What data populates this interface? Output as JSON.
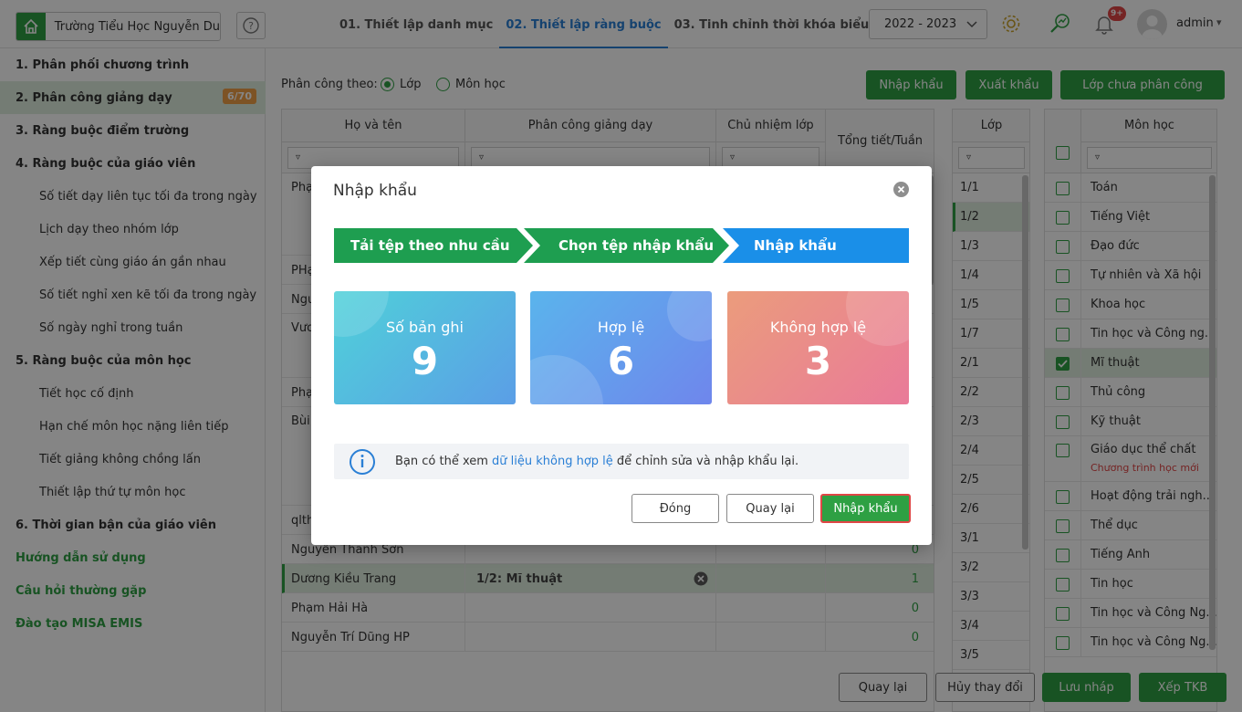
{
  "header": {
    "school_name": "Trường Tiểu Học Nguyễn Du",
    "steps": [
      {
        "label": "01. Thiết lập danh mục"
      },
      {
        "label": "02. Thiết lập ràng buộc"
      },
      {
        "label": "03. Tinh chỉnh thời khóa biểu"
      }
    ],
    "year": "2022 - 2023",
    "notification_badge": "9+",
    "username": "admin"
  },
  "sidebar": {
    "items": [
      {
        "label": "1. Phân phối chương trình"
      },
      {
        "label": "2. Phân công giảng dạy",
        "badge": "6/70"
      },
      {
        "label": "3. Ràng buộc điểm trường"
      },
      {
        "label": "4. Ràng buộc của giáo viên"
      },
      {
        "label": "Số tiết dạy liên tục tối đa trong ngày"
      },
      {
        "label": "Lịch dạy theo nhóm lớp"
      },
      {
        "label": "Xếp tiết cùng giáo án gần nhau"
      },
      {
        "label": "Số tiết nghỉ xen kẽ tối đa trong ngày"
      },
      {
        "label": "Số ngày nghỉ trong tuần"
      },
      {
        "label": "5. Ràng buộc của môn học"
      },
      {
        "label": "Tiết học cố định"
      },
      {
        "label": "Hạn chế môn học nặng liên tiếp"
      },
      {
        "label": "Tiết giảng không chồng lấn"
      },
      {
        "label": "Thiết lập thứ tự môn học"
      },
      {
        "label": "6. Thời gian bận của giáo viên"
      },
      {
        "label": "Hướng dẫn sử dụng"
      },
      {
        "label": "Câu hỏi thường gặp"
      },
      {
        "label": "Đào tạo MISA EMIS"
      }
    ]
  },
  "toolbar": {
    "assign_by_label": "Phân công theo:",
    "radio_class": "Lớp",
    "radio_subject": "Môn học",
    "import_label": "Nhập khẩu",
    "export_label": "Xuất khẩu",
    "unassigned_label": "Lớp chưa phân công"
  },
  "teacher_grid": {
    "columns": [
      "Họ và tên",
      "Phân công giảng dạy",
      "Chủ nhiệm lớp",
      "Tổng tiết/Tuần"
    ],
    "filter_symbol": "▿",
    "rows": [
      {
        "name": "Phạ",
        "assign": "",
        "total": ""
      },
      {
        "name": "PHạ",
        "assign": "",
        "total": ""
      },
      {
        "name": "Ngu",
        "assign": "",
        "total": ""
      },
      {
        "name": "Vươ",
        "assign": "",
        "total": ""
      },
      {
        "name": "Phạ",
        "assign": "",
        "total": ""
      },
      {
        "name": "Bùi",
        "assign": "",
        "total": ""
      },
      {
        "name": "qlth",
        "assign": "",
        "total": ""
      },
      {
        "name": "Nguyễn Thanh Sơn",
        "assign": "",
        "total": "0"
      },
      {
        "name": "Dương Kiều Trang",
        "assign": "1/2: Mĩ thuật",
        "total": "1"
      },
      {
        "name": "Phạm Hải Hà",
        "assign": "",
        "total": "0"
      },
      {
        "name": "Nguyễn Trí Dũng HP",
        "assign": "",
        "total": "0"
      }
    ]
  },
  "class_grid": {
    "header": "Lớp",
    "rows": [
      "1/1",
      "1/2",
      "1/3",
      "1/4",
      "1/5",
      "1/7",
      "2/1",
      "2/2",
      "2/3",
      "2/4",
      "2/5",
      "2/6",
      "3/1",
      "3/2",
      "3/3",
      "3/4",
      "3/5"
    ]
  },
  "subject_grid": {
    "header": "Môn học",
    "rows": [
      {
        "name": "Toán"
      },
      {
        "name": "Tiếng Việt"
      },
      {
        "name": "Đạo đức"
      },
      {
        "name": "Tự nhiên và Xã hội"
      },
      {
        "name": "Khoa học"
      },
      {
        "name": "Tin học và Công ng..."
      },
      {
        "name": "Mĩ thuật"
      },
      {
        "name": "Thủ công"
      },
      {
        "name": "Kỹ thuật"
      },
      {
        "name": "Giáo dục thể chất",
        "sub": "Chương trình học mới"
      },
      {
        "name": "Hoạt động trải ngh..."
      },
      {
        "name": "Thể dục"
      },
      {
        "name": "Tiếng Anh"
      },
      {
        "name": "Tin học"
      },
      {
        "name": "Tin học và Công Ng..."
      },
      {
        "name": "Tin học và Công Ng..."
      }
    ]
  },
  "footer": {
    "back_label": "Quay lại",
    "cancel_label": "Hủy thay đổi",
    "save_draft_label": "Lưu nháp",
    "schedule_label": "Xếp TKB"
  },
  "modal": {
    "title": "Nhập khẩu",
    "wizard_steps": [
      "Tải tệp theo nhu cầu",
      "Chọn tệp nhập khẩu",
      "Nhập khẩu"
    ],
    "stats": [
      {
        "label": "Số bản ghi",
        "value": "9"
      },
      {
        "label": "Hợp lệ",
        "value": "6"
      },
      {
        "label": "Không hợp lệ",
        "value": "3"
      }
    ],
    "info_prefix": "Bạn có thể xem ",
    "info_link": "dữ liệu không hợp lệ",
    "info_suffix": " để chỉnh sửa và nhập khẩu lại.",
    "close_label": "Đóng",
    "back_label": "Quay lại",
    "import_label": "Nhập khẩu"
  }
}
